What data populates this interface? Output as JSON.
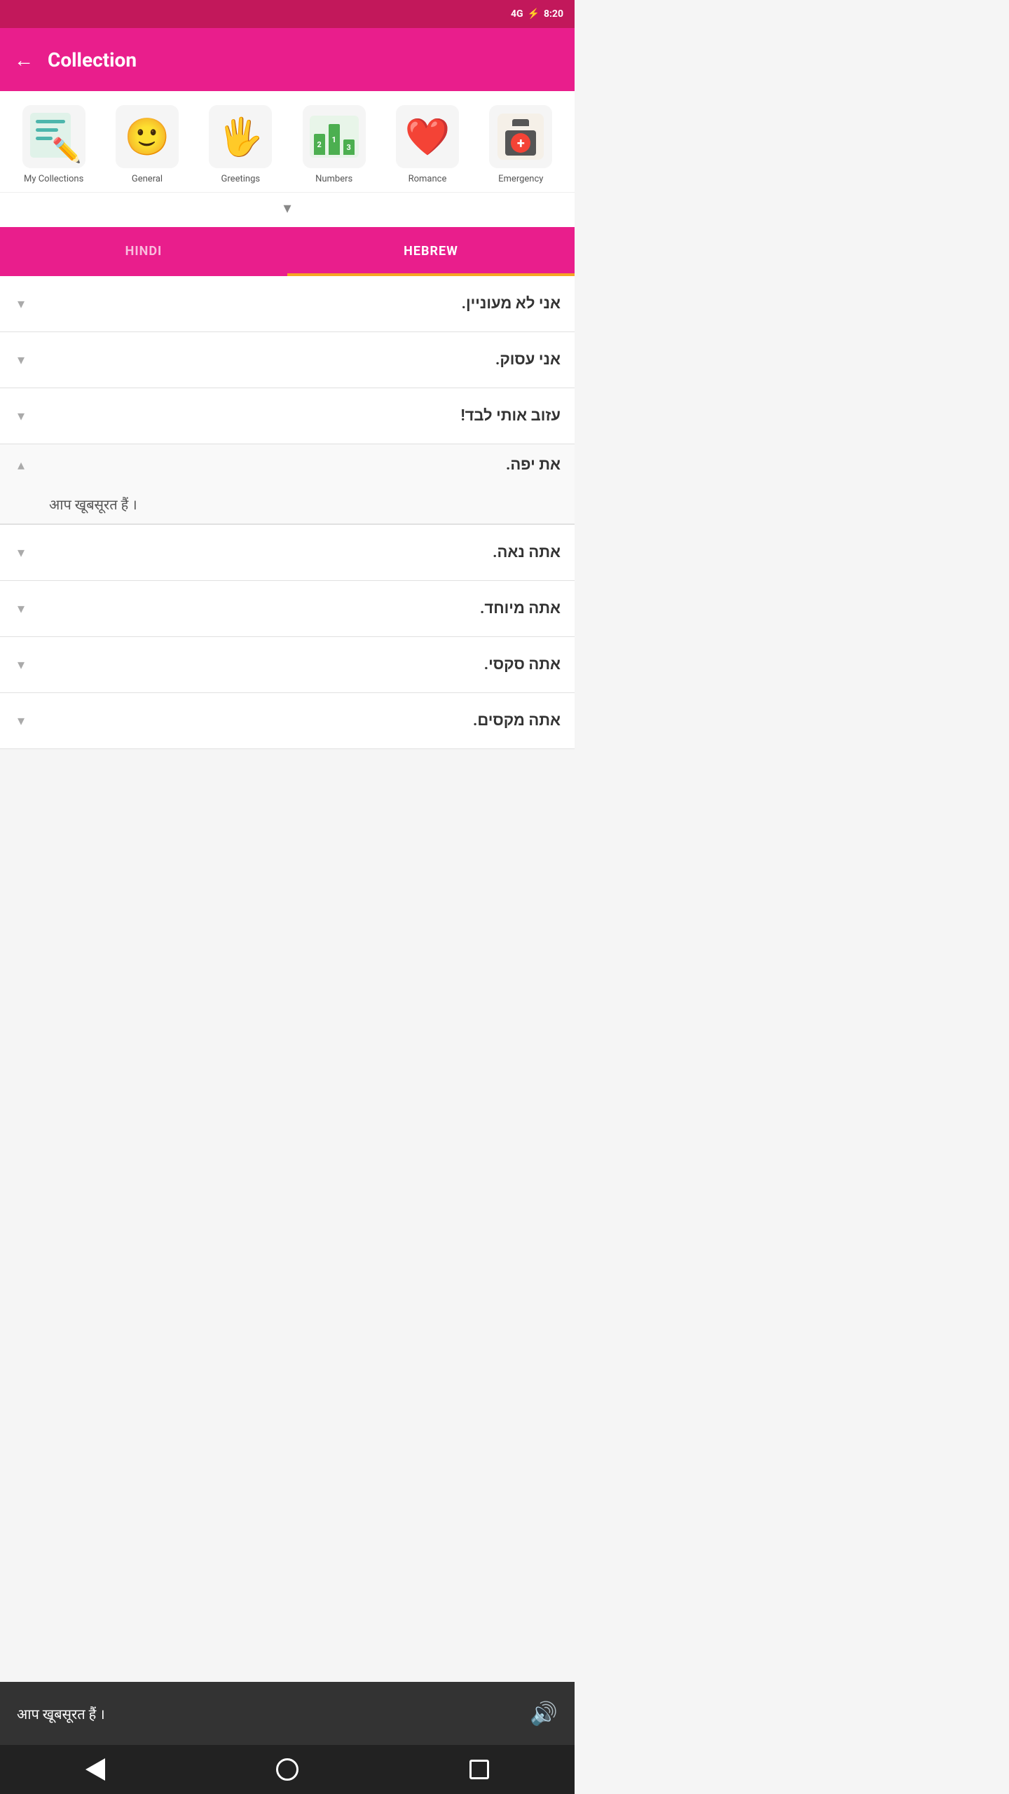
{
  "statusBar": {
    "network": "4G",
    "time": "8:20",
    "batteryIcon": "🔋"
  },
  "header": {
    "backLabel": "←",
    "title": "Collection"
  },
  "categories": [
    {
      "id": "my-collections",
      "icon": "📝",
      "label": "My Collections"
    },
    {
      "id": "general",
      "icon": "😄",
      "label": "General"
    },
    {
      "id": "greetings",
      "icon": "✋",
      "label": "Greetings"
    },
    {
      "id": "numbers",
      "icon": "🔢",
      "label": "Numbers"
    },
    {
      "id": "romance",
      "icon": "❤️",
      "label": "Romance"
    },
    {
      "id": "emergency",
      "icon": "🚑",
      "label": "Emergency"
    }
  ],
  "tabs": [
    {
      "id": "hindi",
      "label": "HINDI",
      "active": false
    },
    {
      "id": "hebrew",
      "label": "HEBREW",
      "active": true
    }
  ],
  "phrases": [
    {
      "id": 1,
      "hebrew": "אני לא מעוניין.",
      "expanded": false,
      "hindi": null
    },
    {
      "id": 2,
      "hebrew": "אני עסוק.",
      "expanded": false,
      "hindi": null
    },
    {
      "id": 3,
      "hebrew": "עזוב אותי לבד!",
      "expanded": false,
      "hindi": null
    },
    {
      "id": 4,
      "hebrew": "את יפה.",
      "expanded": true,
      "hindi": "आप खूबसूरत हैं ।"
    },
    {
      "id": 5,
      "hebrew": "אתה נאה.",
      "expanded": false,
      "hindi": null
    },
    {
      "id": 6,
      "hebrew": "אתה מיוחד.",
      "expanded": false,
      "hindi": null
    },
    {
      "id": 7,
      "hebrew": "אתה סקסי.",
      "expanded": false,
      "hindi": null
    },
    {
      "id": 8,
      "hebrew": "אתה מקסים.",
      "expanded": false,
      "hindi": null
    }
  ],
  "bottomBar": {
    "phrase": "आप खूबसूरत हैं ।",
    "speakerIcon": "🔊"
  },
  "navBar": {
    "backLabel": "◀",
    "homeLabel": "○",
    "recentLabel": "□"
  }
}
